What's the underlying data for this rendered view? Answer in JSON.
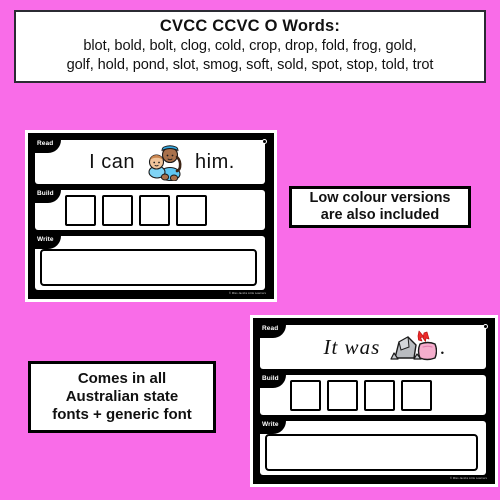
{
  "background_color": "#f96ce8",
  "header": {
    "title": "CVCC CCVC O Words:",
    "words_line1": "blot, bold, bolt, clog, cold, crop, drop, fold, frog, gold,",
    "words_line2": "golf, hold, pond, slot, smog, soft, sold, spot, stop, told, trot"
  },
  "cards": [
    {
      "id": "card-hold",
      "read_label": "Read",
      "build_label": "Build",
      "write_label": "Write",
      "sentence_before": "I can",
      "sentence_after": "him.",
      "picture_name": "person-holding-baby-image",
      "picture_word": "hold",
      "font_style": "print",
      "letter_box_count": 4,
      "credit": "© Miss Jacobs Little Learners"
    },
    {
      "id": "card-soft",
      "read_label": "Read",
      "build_label": "Build",
      "write_label": "Write",
      "sentence_before": "It was",
      "sentence_after": ".",
      "picture_name": "rock-and-soft-pillow-image",
      "picture_word": "soft",
      "font_style": "cursive",
      "letter_box_count": 4,
      "credit": "© Miss Jacobs Little Learners"
    }
  ],
  "callouts": {
    "low_colour": {
      "line1": "Low colour versions",
      "line2": "are also included"
    },
    "fonts": {
      "line1": "Comes in all",
      "line2": "Australian state",
      "line3": "fonts + generic font"
    }
  }
}
